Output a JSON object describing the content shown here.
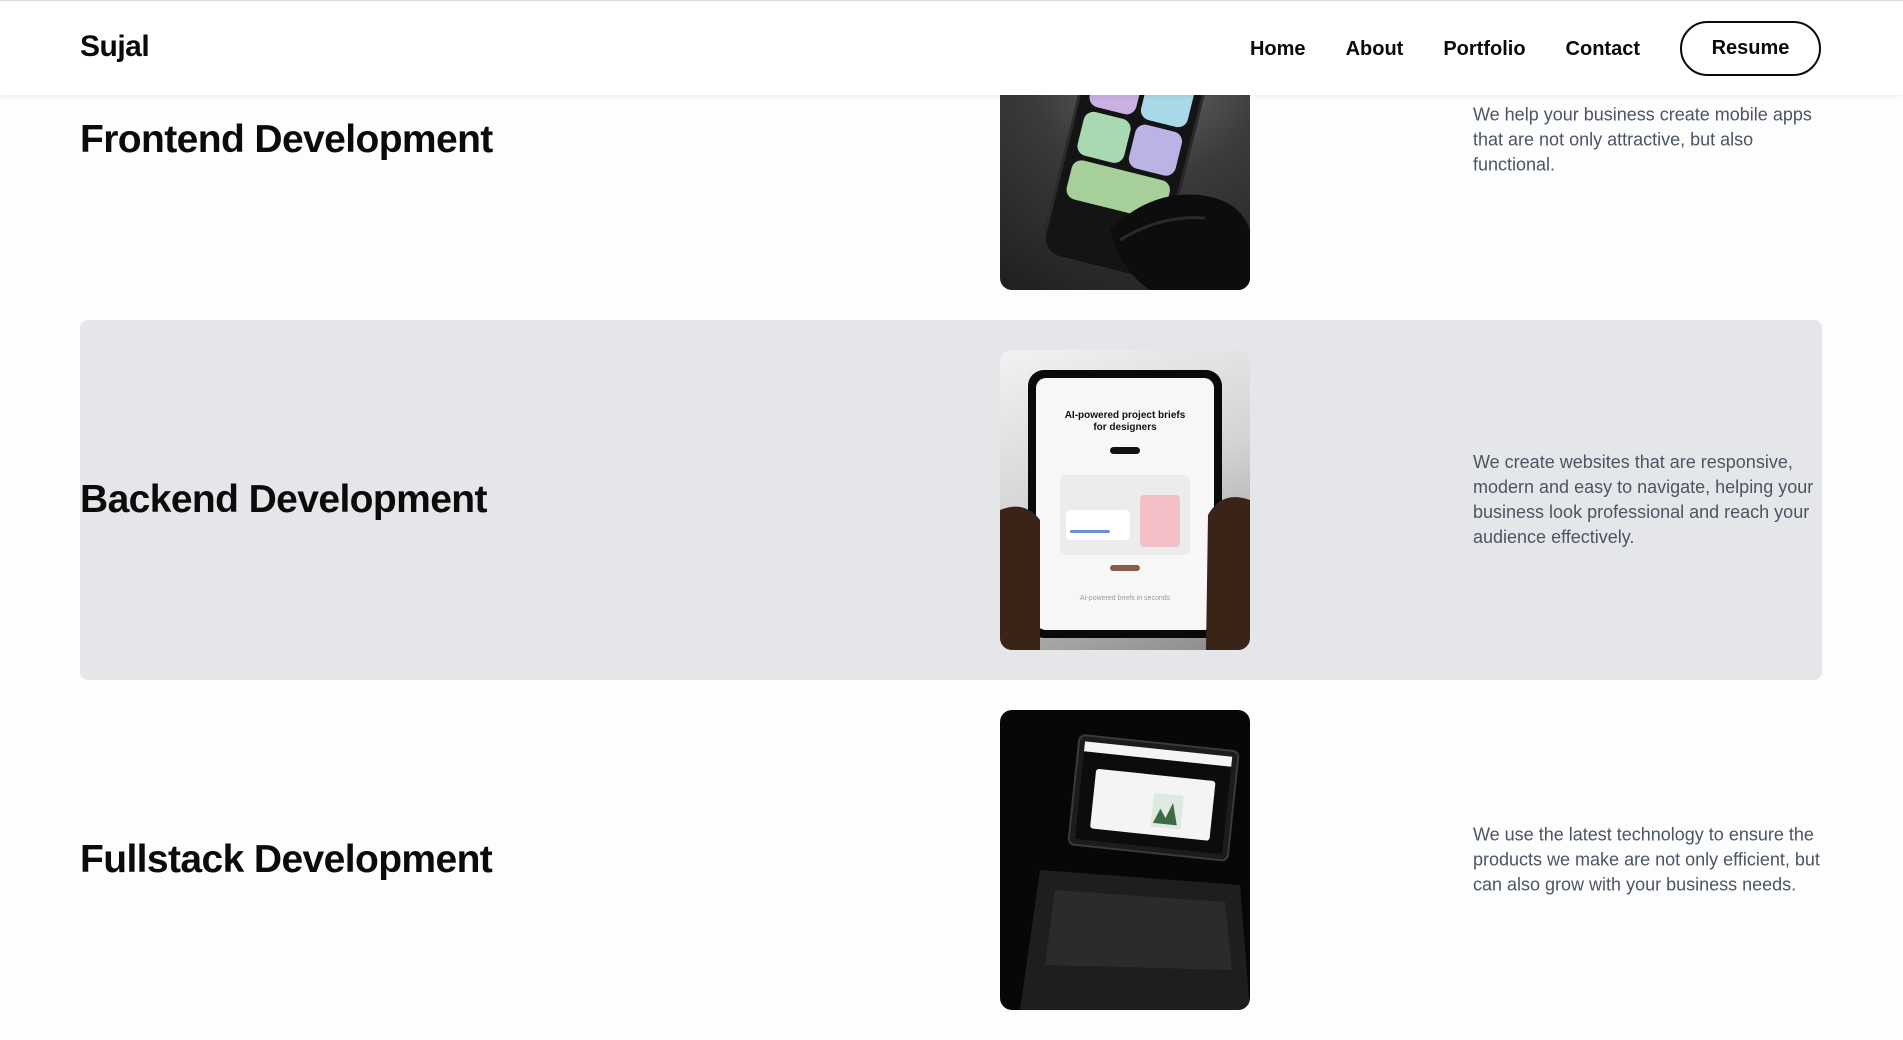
{
  "header": {
    "brand": "Sujal",
    "nav": [
      "Home",
      "About",
      "Portfolio",
      "Contact"
    ],
    "resume_label": "Resume"
  },
  "services": [
    {
      "title": "Frontend Development",
      "description": "We help your business create mobile apps that are not only attractive, but also functional.",
      "highlighted": false
    },
    {
      "title": "Backend Development",
      "description": "We create websites that are responsive, modern and easy to navigate, helping your business look professional and reach your audience effectively.",
      "highlighted": true,
      "image_text": {
        "headline_1": "AI-powered project briefs",
        "headline_2": "for designers",
        "caption": "AI-powered briefs in seconds"
      }
    },
    {
      "title": "Fullstack Development",
      "description": "We use the latest technology to ensure the products we make are not only efficient, but can also grow with your business needs.",
      "highlighted": false
    }
  ],
  "colors": {
    "page_bg": "#fdfdfd",
    "highlight_bg": "#e5e6e9",
    "text": "#0b0b0b",
    "muted_text": "#4b5563"
  }
}
